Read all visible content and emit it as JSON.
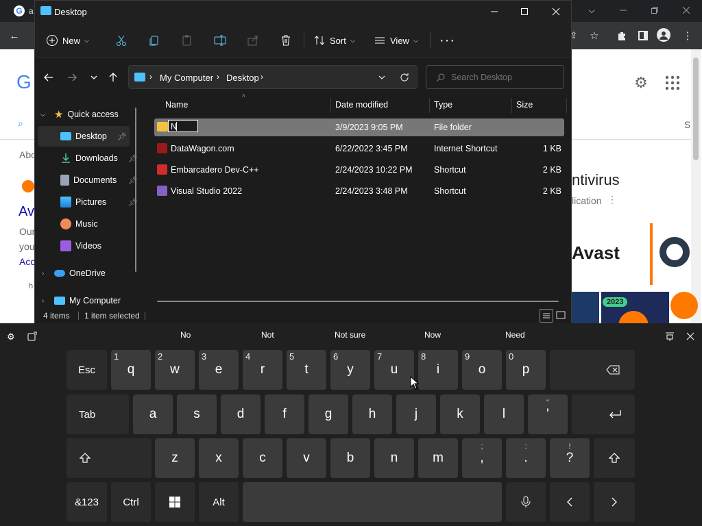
{
  "chrome": {
    "tab_letter": "a",
    "google_partial": "G",
    "search_tab_partial": "S",
    "about_partial": "Abo",
    "result_partial": "Av",
    "our_partial": "Our",
    "you_partial": "you",
    "acc_partial": "Acc",
    "h_partial": "h",
    "antivirus_partial": "ntivirus",
    "application_partial": "lication",
    "avast_text": "Avast",
    "year_badge": "2023"
  },
  "explorer": {
    "title": "Desktop",
    "toolbar": {
      "new_label": "New",
      "sort_label": "Sort",
      "view_label": "View"
    },
    "breadcrumb": [
      "My Computer",
      "Desktop"
    ],
    "search_placeholder": "Search Desktop",
    "sidebar": [
      {
        "label": "Quick access",
        "icon": "star-icon"
      },
      {
        "label": "Desktop",
        "icon": "desktop-icon",
        "pinned": true
      },
      {
        "label": "Downloads",
        "icon": "download-icon",
        "pinned": true
      },
      {
        "label": "Documents",
        "icon": "document-icon",
        "pinned": true
      },
      {
        "label": "Pictures",
        "icon": "picture-icon",
        "pinned": true
      },
      {
        "label": "Music",
        "icon": "music-icon"
      },
      {
        "label": "Videos",
        "icon": "video-icon"
      },
      {
        "label": "OneDrive",
        "icon": "cloud-icon"
      },
      {
        "label": "My Computer",
        "icon": "computer-icon"
      }
    ],
    "columns": [
      "Name",
      "Date modified",
      "Type",
      "Size"
    ],
    "rows": [
      {
        "name": "N",
        "date": "3/9/2023 9:05 PM",
        "type": "File folder",
        "size": ""
      },
      {
        "name": "DataWagon.com",
        "date": "6/22/2022 3:45 PM",
        "type": "Internet Shortcut",
        "size": "1 KB"
      },
      {
        "name": "Embarcadero Dev-C++",
        "date": "2/24/2023 10:22 PM",
        "type": "Shortcut",
        "size": "2 KB"
      },
      {
        "name": "Visual Studio 2022",
        "date": "2/24/2023 3:48 PM",
        "type": "Shortcut",
        "size": "2 KB"
      }
    ],
    "status": {
      "items": "4 items",
      "selected": "1 item selected"
    }
  },
  "keyboard": {
    "suggestions": [
      "No",
      "Not",
      "Not sure",
      "Now",
      "Need"
    ],
    "row1": [
      {
        "label": "Esc"
      },
      {
        "label": "q",
        "num": "1"
      },
      {
        "label": "w",
        "num": "2"
      },
      {
        "label": "e",
        "num": "3"
      },
      {
        "label": "r",
        "num": "4"
      },
      {
        "label": "t",
        "num": "5"
      },
      {
        "label": "y",
        "num": "6"
      },
      {
        "label": "u",
        "num": "7"
      },
      {
        "label": "i",
        "num": "8"
      },
      {
        "label": "o",
        "num": "9"
      },
      {
        "label": "p",
        "num": "0"
      }
    ],
    "row2": [
      {
        "label": "Tab"
      },
      {
        "label": "a"
      },
      {
        "label": "s"
      },
      {
        "label": "d"
      },
      {
        "label": "f"
      },
      {
        "label": "g"
      },
      {
        "label": "h"
      },
      {
        "label": "j"
      },
      {
        "label": "k"
      },
      {
        "label": "l"
      },
      {
        "label": "'",
        "alt": "\""
      }
    ],
    "row3": [
      {
        "label": "z"
      },
      {
        "label": "x"
      },
      {
        "label": "c"
      },
      {
        "label": "v"
      },
      {
        "label": "b"
      },
      {
        "label": "n"
      },
      {
        "label": "m"
      },
      {
        "label": ",",
        "alt": ";"
      },
      {
        "label": ".",
        "alt": ":"
      },
      {
        "label": "?",
        "alt": "!"
      }
    ],
    "row4": {
      "symbols": "&123",
      "ctrl": "Ctrl",
      "alt": "Alt"
    }
  },
  "colors": {
    "accent": "#60cdff",
    "selected_row": "#777777",
    "folder": "#f3c244"
  }
}
